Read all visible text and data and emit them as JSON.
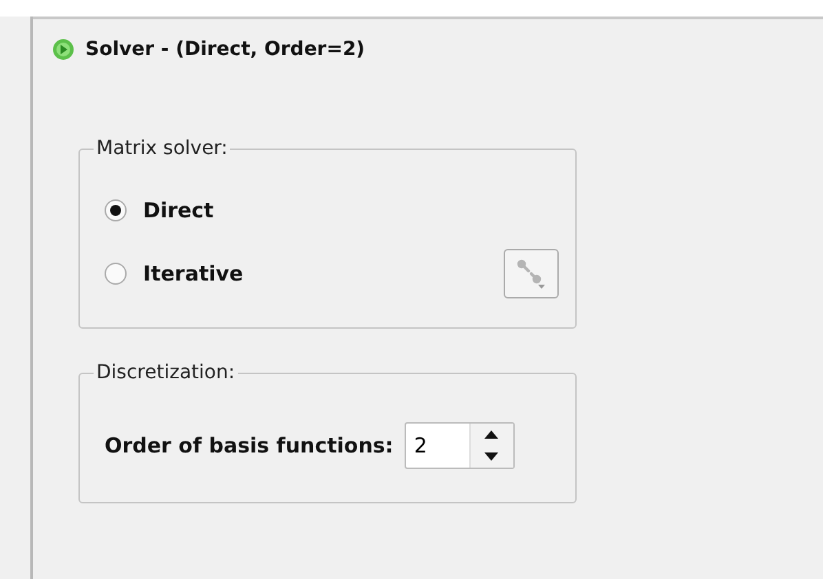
{
  "header": {
    "title": "Solver - (Direct, Order=2)"
  },
  "matrix_solver": {
    "title": "Matrix solver:",
    "options": [
      {
        "label": "Direct",
        "selected": true
      },
      {
        "label": "Iterative",
        "selected": false
      }
    ],
    "settings_button": {
      "disabled": true
    }
  },
  "discretization": {
    "title": "Discretization:",
    "order": {
      "label": "Order of basis functions:",
      "value": "2"
    }
  }
}
